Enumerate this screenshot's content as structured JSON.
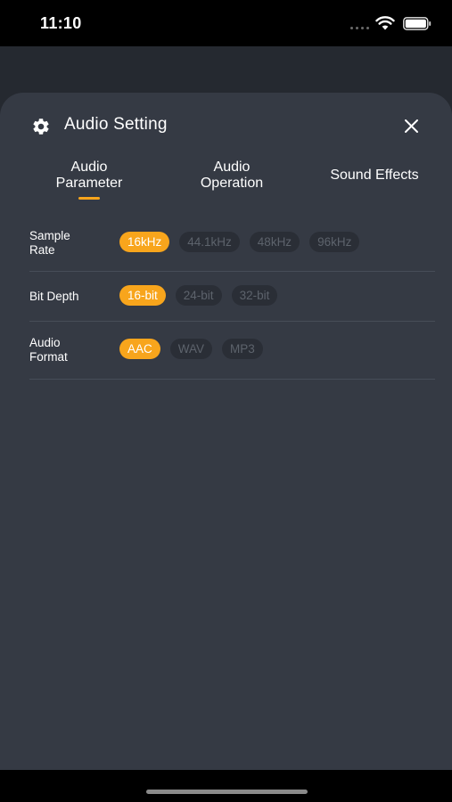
{
  "status_bar": {
    "time": "11:10"
  },
  "sheet": {
    "title": "Audio Setting",
    "icons": {
      "header": "gear-icon",
      "close": "close-icon"
    }
  },
  "tabs": [
    {
      "label_line1": "Audio",
      "label_line2": "Parameter",
      "selected": true
    },
    {
      "label_line1": "Audio",
      "label_line2": "Operation",
      "selected": false
    },
    {
      "label_line1": "Sound Effects",
      "label_line2": "",
      "selected": false
    }
  ],
  "settings": [
    {
      "label_line1": "Sample",
      "label_line2": "Rate",
      "options": [
        "16kHz",
        "44.1kHz",
        "48kHz",
        "96kHz"
      ],
      "selected": "16kHz"
    },
    {
      "label_line1": "Bit Depth",
      "label_line2": "",
      "options": [
        "16-bit",
        "24-bit",
        "32-bit"
      ],
      "selected": "16-bit"
    },
    {
      "label_line1": "Audio",
      "label_line2": "Format",
      "options": [
        "AAC",
        "WAV",
        "MP3"
      ],
      "selected": "AAC"
    }
  ],
  "colors": {
    "accent": "#f8a51c",
    "sheet_bg": "#353a44",
    "chip_bg": "#2a2e36",
    "chip_text": "#5d636c"
  }
}
